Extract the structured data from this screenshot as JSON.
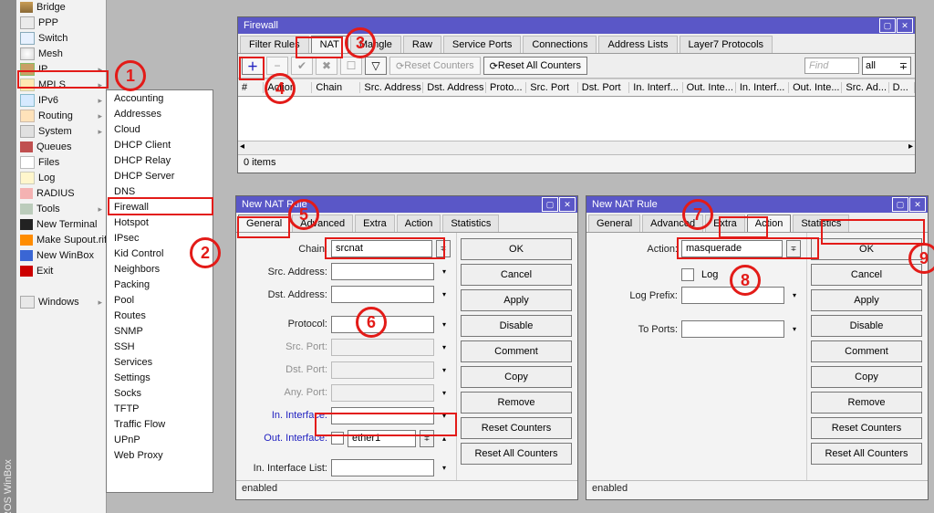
{
  "app_tag": "ROS WinBox",
  "main_menu": [
    {
      "label": "Bridge",
      "icon": "bridge"
    },
    {
      "label": "PPP",
      "icon": "ppp"
    },
    {
      "label": "Switch",
      "icon": "switch"
    },
    {
      "label": "Mesh",
      "icon": "mesh"
    },
    {
      "label": "IP",
      "icon": "ip",
      "chevron": true
    },
    {
      "label": "MPLS",
      "icon": "mpls",
      "chevron": true
    },
    {
      "label": "IPv6",
      "icon": "ipv6",
      "chevron": true
    },
    {
      "label": "Routing",
      "icon": "route",
      "chevron": true
    },
    {
      "label": "System",
      "icon": "system",
      "chevron": true
    },
    {
      "label": "Queues",
      "icon": "queues"
    },
    {
      "label": "Files",
      "icon": "files"
    },
    {
      "label": "Log",
      "icon": "log"
    },
    {
      "label": "RADIUS",
      "icon": "radius"
    },
    {
      "label": "Tools",
      "icon": "tools",
      "chevron": true
    },
    {
      "label": "New Terminal",
      "icon": "term"
    },
    {
      "label": "Make Supout.rif",
      "icon": "star"
    },
    {
      "label": "New WinBox",
      "icon": "winbox"
    },
    {
      "label": "Exit",
      "icon": "exit"
    },
    {
      "label": "",
      "icon": ""
    },
    {
      "label": "Windows",
      "icon": "windows",
      "chevron": true
    }
  ],
  "sub_menu": [
    "Accounting",
    "Addresses",
    "Cloud",
    "DHCP Client",
    "DHCP Relay",
    "DHCP Server",
    "DNS",
    "Firewall",
    "Hotspot",
    "IPsec",
    "Kid Control",
    "Neighbors",
    "Packing",
    "Pool",
    "Routes",
    "SNMP",
    "SSH",
    "Services",
    "Settings",
    "Socks",
    "TFTP",
    "Traffic Flow",
    "UPnP",
    "Web Proxy"
  ],
  "firewall": {
    "title": "Firewall",
    "tabs": [
      "Filter Rules",
      "NAT",
      "Mangle",
      "Raw",
      "Service Ports",
      "Connections",
      "Address Lists",
      "Layer7 Protocols"
    ],
    "active_tab": "NAT",
    "toolbar": {
      "reset_counters": "Reset Counters",
      "reset_all_counters": "Reset All Counters",
      "find_placeholder": "Find",
      "filter_value": "all"
    },
    "columns": [
      "#",
      "Action",
      "Chain",
      "Src. Address",
      "Dst. Address",
      "Proto...",
      "Src. Port",
      "Dst. Port",
      "In. Interf...",
      "Out. Inte...",
      "In. Interf...",
      "Out. Inte...",
      "Src. Ad...",
      "D..."
    ],
    "status": "0 items"
  },
  "nat1": {
    "title": "New NAT Rule",
    "tabs": [
      "General",
      "Advanced",
      "Extra",
      "Action",
      "Statistics"
    ],
    "active_tab": "General",
    "fields": {
      "chain_label": "Chain:",
      "chain_value": "srcnat",
      "src_addr_label": "Src. Address:",
      "dst_addr_label": "Dst. Address:",
      "protocol_label": "Protocol:",
      "src_port_label": "Src. Port:",
      "dst_port_label": "Dst. Port:",
      "any_port_label": "Any. Port:",
      "in_iface_label": "In. Interface:",
      "out_iface_label": "Out. Interface:",
      "out_iface_value": "ether1",
      "in_iface_list_label": "In. Interface List:"
    },
    "buttons": [
      "OK",
      "Cancel",
      "Apply",
      "Disable",
      "Comment",
      "Copy",
      "Remove",
      "Reset Counters",
      "Reset All Counters"
    ],
    "status": "enabled"
  },
  "nat2": {
    "title": "New NAT Rule",
    "tabs": [
      "General",
      "Advanced",
      "Extra",
      "Action",
      "Statistics"
    ],
    "active_tab": "Action",
    "fields": {
      "action_label": "Action:",
      "action_value": "masquerade",
      "log_label": "Log",
      "log_prefix_label": "Log Prefix:",
      "to_ports_label": "To Ports:"
    },
    "buttons": [
      "OK",
      "Cancel",
      "Apply",
      "Disable",
      "Comment",
      "Copy",
      "Remove",
      "Reset Counters",
      "Reset All Counters"
    ],
    "status": "enabled"
  },
  "annotations": {
    "1": "1",
    "2": "2",
    "3": "3",
    "4": "4",
    "5": "5",
    "6": "6",
    "7": "7",
    "8": "8",
    "9": "9"
  }
}
